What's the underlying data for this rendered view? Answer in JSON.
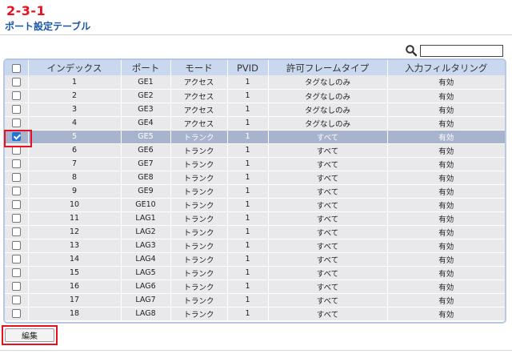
{
  "step_label": "2-3-1",
  "page_title": "ポート設定テーブル",
  "search": {
    "value": "",
    "placeholder": ""
  },
  "table": {
    "columns": [
      "インデックス",
      "ポート",
      "モード",
      "PVID",
      "許可フレームタイプ",
      "入力フィルタリング"
    ],
    "select_all_checked": false,
    "rows": [
      {
        "index": "1",
        "port": "GE1",
        "mode": "アクセス",
        "pvid": "1",
        "frame_type": "タグなしのみ",
        "ingress": "有効",
        "checked": false
      },
      {
        "index": "2",
        "port": "GE2",
        "mode": "アクセス",
        "pvid": "1",
        "frame_type": "タグなしのみ",
        "ingress": "有効",
        "checked": false
      },
      {
        "index": "3",
        "port": "GE3",
        "mode": "アクセス",
        "pvid": "1",
        "frame_type": "タグなしのみ",
        "ingress": "有効",
        "checked": false
      },
      {
        "index": "4",
        "port": "GE4",
        "mode": "アクセス",
        "pvid": "1",
        "frame_type": "タグなしのみ",
        "ingress": "有効",
        "checked": false
      },
      {
        "index": "5",
        "port": "GE5",
        "mode": "トランク",
        "pvid": "1",
        "frame_type": "すべて",
        "ingress": "有効",
        "checked": true
      },
      {
        "index": "6",
        "port": "GE6",
        "mode": "トランク",
        "pvid": "1",
        "frame_type": "すべて",
        "ingress": "有効",
        "checked": false
      },
      {
        "index": "7",
        "port": "GE7",
        "mode": "トランク",
        "pvid": "1",
        "frame_type": "すべて",
        "ingress": "有効",
        "checked": false
      },
      {
        "index": "8",
        "port": "GE8",
        "mode": "トランク",
        "pvid": "1",
        "frame_type": "すべて",
        "ingress": "有効",
        "checked": false
      },
      {
        "index": "9",
        "port": "GE9",
        "mode": "トランク",
        "pvid": "1",
        "frame_type": "すべて",
        "ingress": "有効",
        "checked": false
      },
      {
        "index": "10",
        "port": "GE10",
        "mode": "トランク",
        "pvid": "1",
        "frame_type": "すべて",
        "ingress": "有効",
        "checked": false
      },
      {
        "index": "11",
        "port": "LAG1",
        "mode": "トランク",
        "pvid": "1",
        "frame_type": "すべて",
        "ingress": "有効",
        "checked": false
      },
      {
        "index": "12",
        "port": "LAG2",
        "mode": "トランク",
        "pvid": "1",
        "frame_type": "すべて",
        "ingress": "有効",
        "checked": false
      },
      {
        "index": "13",
        "port": "LAG3",
        "mode": "トランク",
        "pvid": "1",
        "frame_type": "すべて",
        "ingress": "有効",
        "checked": false
      },
      {
        "index": "14",
        "port": "LAG4",
        "mode": "トランク",
        "pvid": "1",
        "frame_type": "すべて",
        "ingress": "有効",
        "checked": false
      },
      {
        "index": "15",
        "port": "LAG5",
        "mode": "トランク",
        "pvid": "1",
        "frame_type": "すべて",
        "ingress": "有効",
        "checked": false
      },
      {
        "index": "16",
        "port": "LAG6",
        "mode": "トランク",
        "pvid": "1",
        "frame_type": "すべて",
        "ingress": "有効",
        "checked": false
      },
      {
        "index": "17",
        "port": "LAG7",
        "mode": "トランク",
        "pvid": "1",
        "frame_type": "すべて",
        "ingress": "有効",
        "checked": false
      },
      {
        "index": "18",
        "port": "LAG8",
        "mode": "トランク",
        "pvid": "1",
        "frame_type": "すべて",
        "ingress": "有効",
        "checked": false
      }
    ]
  },
  "edit_button_label": "編集",
  "colors": {
    "accent_red": "#e8101c",
    "title_blue": "#1a57a8",
    "header_bg": "#c9d7ef",
    "row_bg": "#e9e9ec",
    "selected_row_bg": "#a8b3ce"
  }
}
